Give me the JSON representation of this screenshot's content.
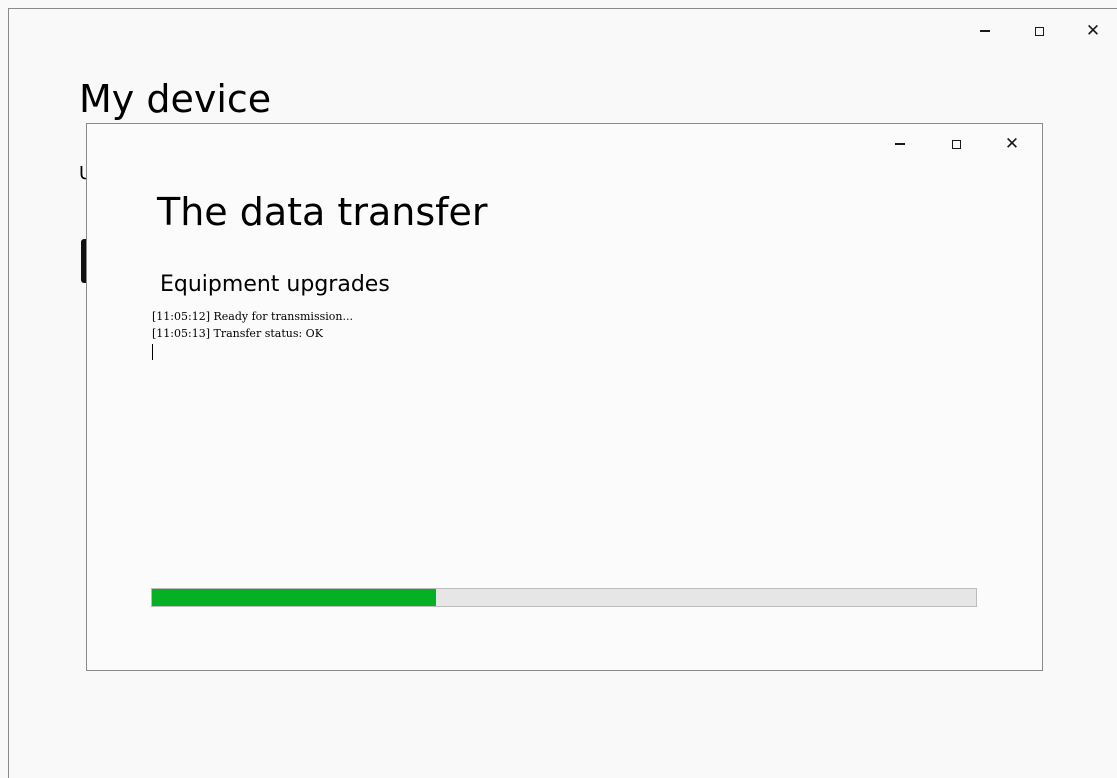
{
  "main_window": {
    "title": "My device",
    "subtitle_partial": "U",
    "caption": {
      "minimize_icon": "minimize-icon",
      "maximize_icon": "maximize-icon",
      "close_glyph": "✕"
    }
  },
  "dialog": {
    "title": "The data transfer",
    "subtitle": "Equipment upgrades",
    "caption": {
      "close_glyph": "✕"
    },
    "log": [
      "[11:05:12] Ready for transmission...",
      "[11:05:13] Transfer status: OK"
    ],
    "progress": {
      "percent": 34.5,
      "fill_color": "#06b025",
      "track_color": "#e6e6e6"
    }
  }
}
